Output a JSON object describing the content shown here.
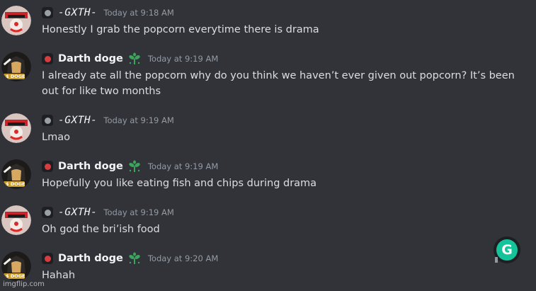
{
  "colors": {
    "background": "#313338",
    "text": "#dbdee1",
    "username": "#f2f3f5",
    "timestamp": "#949ba4",
    "role_dot_gxth": "#9aa0a6",
    "role_dot_darth": "#d83c3e",
    "sprout": "#3ba55d",
    "grammarly": "#15c39a"
  },
  "messages": [
    {
      "author": "-GXTH-",
      "avatar_icon": "clown-avatar-icon",
      "role_color": "#9aa0a6",
      "has_badge": false,
      "timestamp": "Today at 9:18 AM",
      "content": "Honestly I grab the popcorn everytime there is drama"
    },
    {
      "author": "Darth doge",
      "avatar_icon": "doge-avatar-icon",
      "role_color": "#d83c3e",
      "has_badge": true,
      "timestamp": "Today at 9:19 AM",
      "content": "I already ate all the popcorn why do you think we haven’t ever given out popcorn? It’s been out for like two months"
    },
    {
      "author": "-GXTH-",
      "avatar_icon": "clown-avatar-icon",
      "role_color": "#9aa0a6",
      "has_badge": false,
      "timestamp": "Today at 9:19 AM",
      "content": "Lmao"
    },
    {
      "author": "Darth doge",
      "avatar_icon": "doge-avatar-icon",
      "role_color": "#d83c3e",
      "has_badge": true,
      "timestamp": "Today at 9:19 AM",
      "content": "Hopefully you like eating fish and chips during drama"
    },
    {
      "author": "-GXTH-",
      "avatar_icon": "clown-avatar-icon",
      "role_color": "#9aa0a6",
      "has_badge": false,
      "timestamp": "Today at 9:19 AM",
      "content": "Oh god the bri’ish food"
    },
    {
      "author": "Darth doge",
      "avatar_icon": "doge-avatar-icon",
      "role_color": "#d83c3e",
      "has_badge": true,
      "timestamp": "Today at 9:20 AM",
      "content": "Hahah"
    }
  ],
  "avatar_text": {
    "doge": "$ DOGE"
  },
  "grammarly": {
    "icon": "grammarly-icon",
    "letter": "G"
  },
  "watermark": "imgflip.com"
}
